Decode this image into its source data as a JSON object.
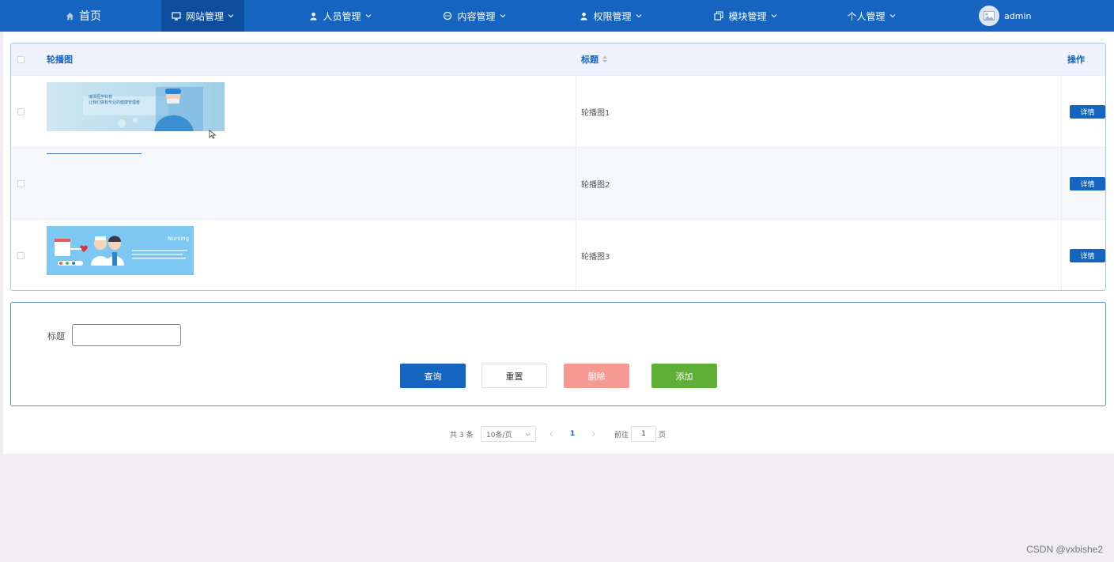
{
  "nav": {
    "home": "首页",
    "items": [
      {
        "label": "网站管理",
        "icon": "monitor-icon"
      },
      {
        "label": "人员管理",
        "icon": "user-icon"
      },
      {
        "label": "内容管理",
        "icon": "chat-icon"
      },
      {
        "label": "权限管理",
        "icon": "user-icon"
      },
      {
        "label": "模块管理",
        "icon": "copy-icon"
      },
      {
        "label": "个人管理",
        "icon": ""
      }
    ],
    "user": "admin"
  },
  "table": {
    "headers": {
      "image": "轮播图",
      "title": "标题",
      "actions": "操作"
    },
    "rows": [
      {
        "title": "轮播图1",
        "action": "详情",
        "image_text": [
          "瑞泽医学科普",
          "让我们做有专业的健康管理者"
        ]
      },
      {
        "title": "轮播图2",
        "action": "详情"
      },
      {
        "title": "轮播图3",
        "action": "详情",
        "image_text": [
          "Nursing"
        ]
      }
    ]
  },
  "search": {
    "label": "标题",
    "value": "",
    "query": "查询",
    "reset": "重置",
    "delete": "删除",
    "add": "添加"
  },
  "pager": {
    "total": "共 3 条",
    "page_size": "10条/页",
    "current": "1",
    "goto": "前往",
    "goto_value": "1",
    "page_suffix": "页"
  },
  "watermark": "CSDN @vxbishe2",
  "colors": {
    "primary": "#1565c0",
    "danger": "#f59a93",
    "success": "#5fae35"
  }
}
